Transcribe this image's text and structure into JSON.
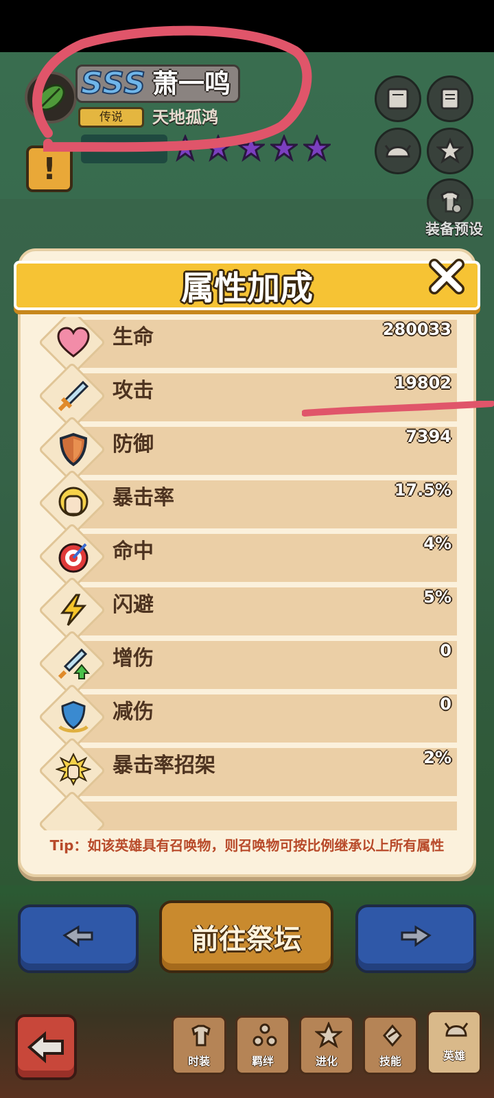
{
  "hero": {
    "rank": "SSS",
    "name": "萧一鸣",
    "rarity": "传说",
    "title": "天地孤鸿",
    "stars": 5
  },
  "side_buttons": {
    "equip_preset_label": "装备预设"
  },
  "dialog": {
    "title": "属性加成",
    "stats": [
      {
        "icon": "heart-icon",
        "label": "生命",
        "value": "280033"
      },
      {
        "icon": "sword-icon",
        "label": "攻击",
        "value": "19802"
      },
      {
        "icon": "shield-icon",
        "label": "防御",
        "value": "7394"
      },
      {
        "icon": "fist-icon",
        "label": "暴击率",
        "value": "17.5%"
      },
      {
        "icon": "target-icon",
        "label": "命中",
        "value": "4%"
      },
      {
        "icon": "lightning-icon",
        "label": "闪避",
        "value": "5%"
      },
      {
        "icon": "sword-up-icon",
        "label": "增伤",
        "value": "0"
      },
      {
        "icon": "shield-down-icon",
        "label": "减伤",
        "value": "0"
      },
      {
        "icon": "block-icon",
        "label": "暴击率招架",
        "value": "2%"
      }
    ],
    "tip": "Tip：如该英雄具有召唤物，则召唤物可按比例继承以上所有属性"
  },
  "actions": {
    "altar_label": "前往祭坛"
  },
  "nav": {
    "tabs": [
      {
        "label": "时装",
        "icon": "outfit-icon"
      },
      {
        "label": "羁绊",
        "icon": "bond-icon"
      },
      {
        "label": "进化",
        "icon": "evolve-icon"
      },
      {
        "label": "技能",
        "icon": "skill-icon"
      },
      {
        "label": "英雄",
        "icon": "hero-icon"
      }
    ]
  },
  "colors": {
    "banner": "#f6c334",
    "dialog_bg": "#fbf1dc",
    "row_bg": "#ebcfa6",
    "tip_text": "#b84a2a",
    "blue_button": "#2f58a8",
    "gold_button": "#c98a2e",
    "back_button": "#c8473a"
  }
}
